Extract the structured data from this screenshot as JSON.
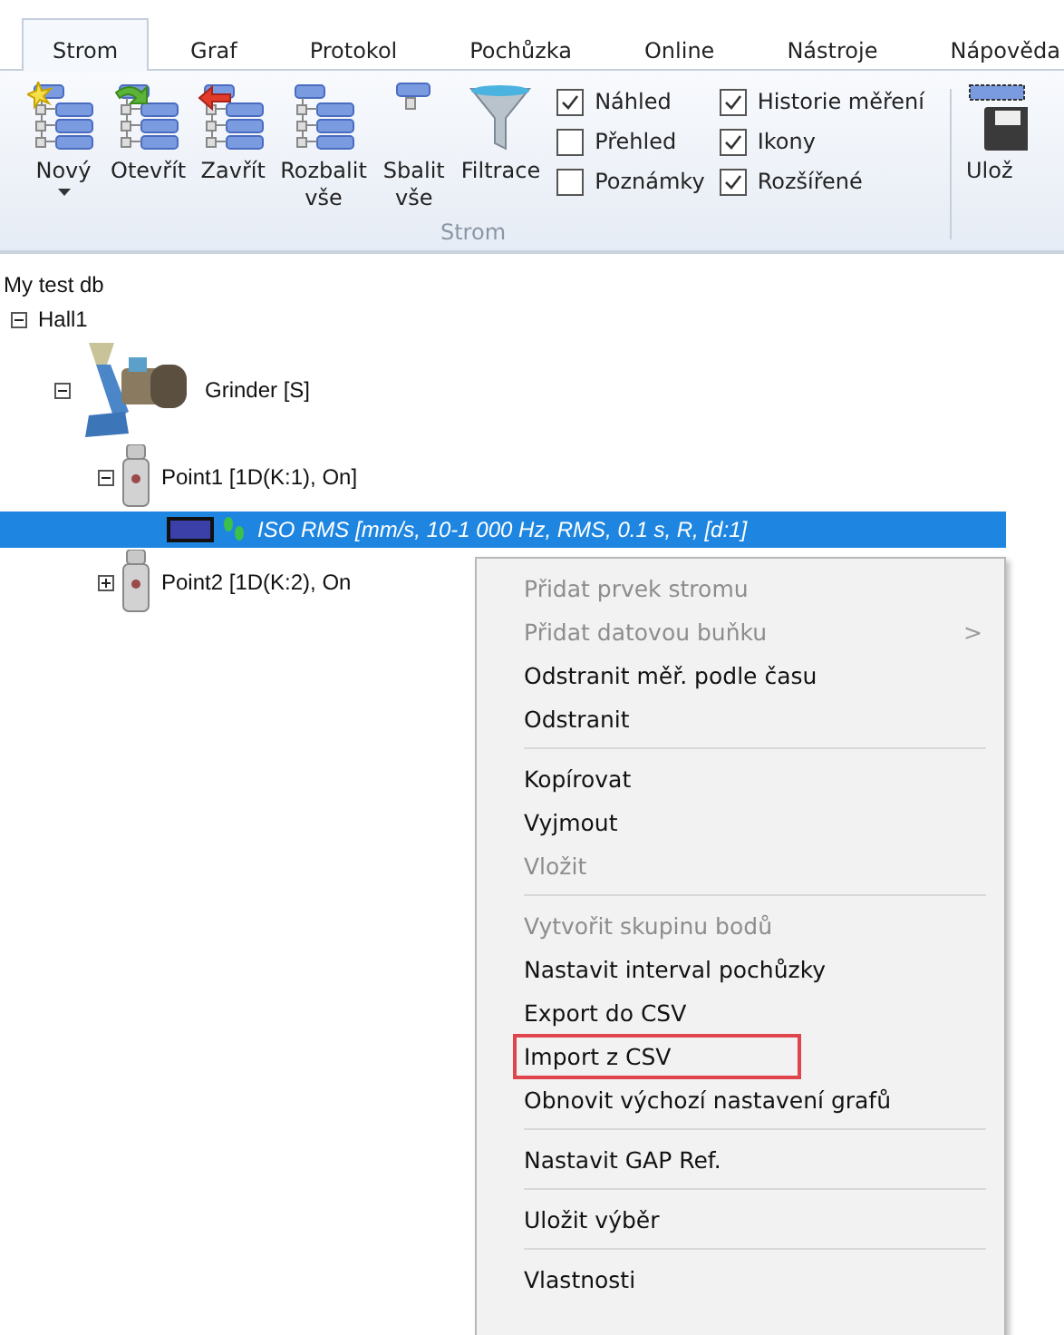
{
  "ribbon": {
    "tabs": [
      {
        "label": "Strom",
        "selected": true
      },
      {
        "label": "Graf",
        "selected": false
      },
      {
        "label": "Protokol",
        "selected": false
      },
      {
        "label": "Pochůzka",
        "selected": false
      },
      {
        "label": "Online",
        "selected": false
      },
      {
        "label": "Nástroje",
        "selected": false
      },
      {
        "label": "Nápověda",
        "selected": false
      }
    ],
    "buttons": [
      {
        "kind": "new",
        "label": "Nový",
        "dropdown": true
      },
      {
        "kind": "open",
        "label": "Otevřít",
        "dropdown": false
      },
      {
        "kind": "close",
        "label": "Zavřít",
        "dropdown": false
      },
      {
        "kind": "expand",
        "label": "Rozbalit vše",
        "dropdown": false
      },
      {
        "kind": "collapse",
        "label": "Sbalit vše",
        "dropdown": false
      },
      {
        "kind": "filter",
        "label": "Filtrace",
        "dropdown": false
      }
    ],
    "checkboxes": [
      {
        "label": "Náhled",
        "checked": true
      },
      {
        "label": "Přehled",
        "checked": false
      },
      {
        "label": "Poznámky",
        "checked": false
      },
      {
        "label": "Historie měření",
        "checked": true
      },
      {
        "label": "Ikony",
        "checked": true
      },
      {
        "label": "Rozšířené",
        "checked": true
      }
    ],
    "group_label": "Strom",
    "save_button": {
      "label": "Ulož"
    }
  },
  "tree": {
    "label": "My test db",
    "children": [
      {
        "kind": "hall",
        "label": "Hall1",
        "expanded": true,
        "selected": false,
        "children": [
          {
            "kind": "machine",
            "label": "Grinder [S]",
            "expanded": true,
            "selected": false,
            "children": [
              {
                "kind": "point",
                "label": "Point1 [1D(K:1), On]",
                "expanded": true,
                "selected": false,
                "children": [
                  {
                    "kind": "measurement",
                    "label": "ISO RMS [mm/s, 10-1 000 Hz, RMS, 0.1 s, R, [d:1]",
                    "selected": true,
                    "color": "#3b3fa8"
                  }
                ]
              },
              {
                "kind": "point",
                "label": "Point2 [1D(K:2), On",
                "expanded": false,
                "selected": false
              }
            ]
          }
        ]
      }
    ]
  },
  "context_menu": {
    "items": [
      {
        "kind": "item",
        "label": "Přidat prvek stromu",
        "disabled": true,
        "highlighted": false
      },
      {
        "kind": "item",
        "label": "Přidat datovou buňku",
        "disabled": true,
        "submenu_arrow": ">",
        "highlighted": false
      },
      {
        "kind": "item",
        "label": "Odstranit měř. podle času",
        "disabled": false,
        "highlighted": false
      },
      {
        "kind": "item",
        "label": "Odstranit",
        "disabled": false,
        "highlighted": false
      },
      {
        "kind": "separator"
      },
      {
        "kind": "item",
        "label": "Kopírovat",
        "disabled": false,
        "highlighted": false
      },
      {
        "kind": "item",
        "label": "Vyjmout",
        "disabled": false,
        "highlighted": false
      },
      {
        "kind": "item",
        "label": "Vložit",
        "disabled": true,
        "highlighted": false
      },
      {
        "kind": "separator"
      },
      {
        "kind": "item",
        "label": "Vytvořit skupinu bodů",
        "disabled": true,
        "highlighted": false
      },
      {
        "kind": "item",
        "label": "Nastavit interval pochůzky",
        "disabled": false,
        "highlighted": false
      },
      {
        "kind": "item",
        "label": "Export do CSV",
        "disabled": false,
        "highlighted": false
      },
      {
        "kind": "item",
        "label": "Import z CSV",
        "disabled": false,
        "highlighted": true
      },
      {
        "kind": "item",
        "label": "Obnovit výchozí nastavení grafů",
        "disabled": false,
        "highlighted": false
      },
      {
        "kind": "separator"
      },
      {
        "kind": "item",
        "label": "Nastavit GAP Ref.",
        "disabled": false,
        "highlighted": false
      },
      {
        "kind": "separator"
      },
      {
        "kind": "item",
        "label": "Uložit výběr",
        "disabled": false,
        "highlighted": false
      },
      {
        "kind": "separator"
      },
      {
        "kind": "item",
        "label": "Vlastnosti",
        "disabled": false,
        "highlighted": false
      }
    ]
  }
}
